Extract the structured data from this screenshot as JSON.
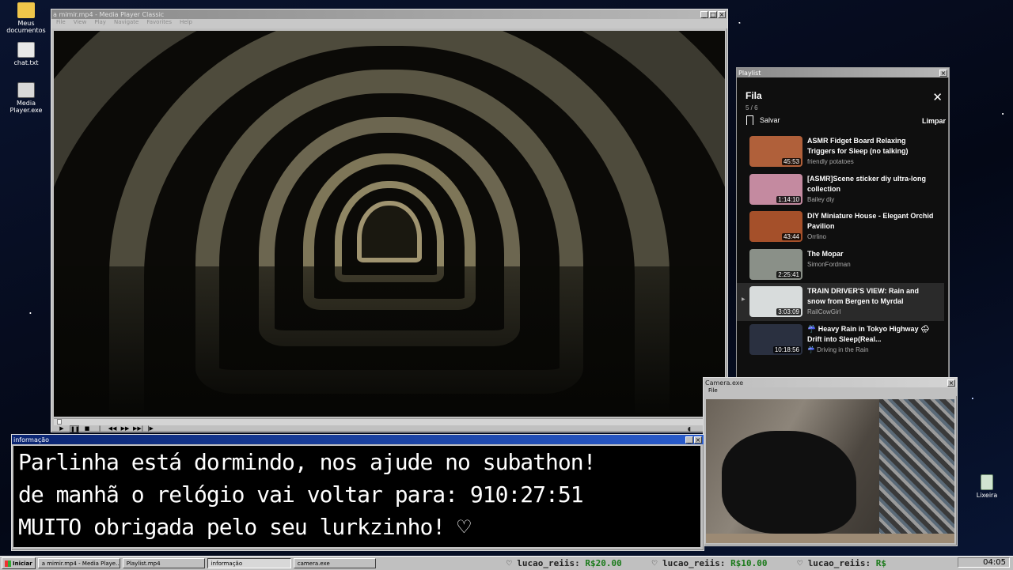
{
  "desktop": {
    "icons": [
      {
        "label": "Meus documentos"
      },
      {
        "label": "chat.txt"
      },
      {
        "label": "Media Player.exe"
      }
    ],
    "recycle_bin": "Lixeira"
  },
  "media_player": {
    "title": "a mimir.mp4 - Media Player Classic",
    "menu": [
      "File",
      "View",
      "Play",
      "Navigate",
      "Favorites",
      "Help"
    ]
  },
  "playlist": {
    "window_title": "Playlist",
    "heading": "Fila",
    "count": "5 / 6",
    "save_label": "Salvar",
    "clear_label": "Limpar",
    "items": [
      {
        "title": "ASMR Fidget Board Relaxing Triggers for Sleep (no talking)",
        "channel": "friendly potatoes",
        "duration": "45:53",
        "thumb_color": "#b0603a"
      },
      {
        "title": "[ASMR]Scene sticker diy ultra-long collection",
        "channel": "Bailey diy",
        "duration": "1:14:10",
        "thumb_color": "#c48aa0"
      },
      {
        "title": "DIY Miniature House - Elegant Orchid Pavilion",
        "channel": "Orrlino",
        "duration": "43:44",
        "thumb_color": "#a5502a"
      },
      {
        "title": "The Mopar",
        "channel": "SimonFordman",
        "duration": "2:25:41",
        "thumb_color": "#8a9088"
      },
      {
        "title": "TRAIN DRIVER'S VIEW: Rain and snow from Bergen to Myrdal",
        "channel": "RailCowGirl",
        "duration": "3:03:09",
        "thumb_color": "#d8dcdc"
      },
      {
        "title": "☔ Heavy Rain in Tokyo Highway 🌧 Drift into Sleep(Real...",
        "channel": "☔ Driving in the Rain",
        "duration": "10:18:56",
        "thumb_color": "#2a3040"
      }
    ],
    "current_index": 4
  },
  "info": {
    "title": "informação",
    "lines": [
      "Parlinha está dormindo, nos ajude no subathon!",
      "de manhã o relógio vai voltar para:  910:27:51",
      "MUITO obrigada pelo seu lurkzinho! ♡"
    ]
  },
  "camera": {
    "title": "Camera.exe",
    "menu": "File"
  },
  "taskbar": {
    "start": "Iniciar",
    "tasks": [
      "a mimir.mp4 - Media Playe...",
      "Playlist.mp4",
      "informação",
      "camera.exe"
    ],
    "pressed_index": 2,
    "ticker": [
      {
        "user": "lucao_reiis:",
        "amount": "R$20.00"
      },
      {
        "user": "lucao_reiis:",
        "amount": "R$10.00"
      },
      {
        "user": "lucao_reiis:",
        "amount": "R$"
      }
    ],
    "clock": "04:05"
  }
}
